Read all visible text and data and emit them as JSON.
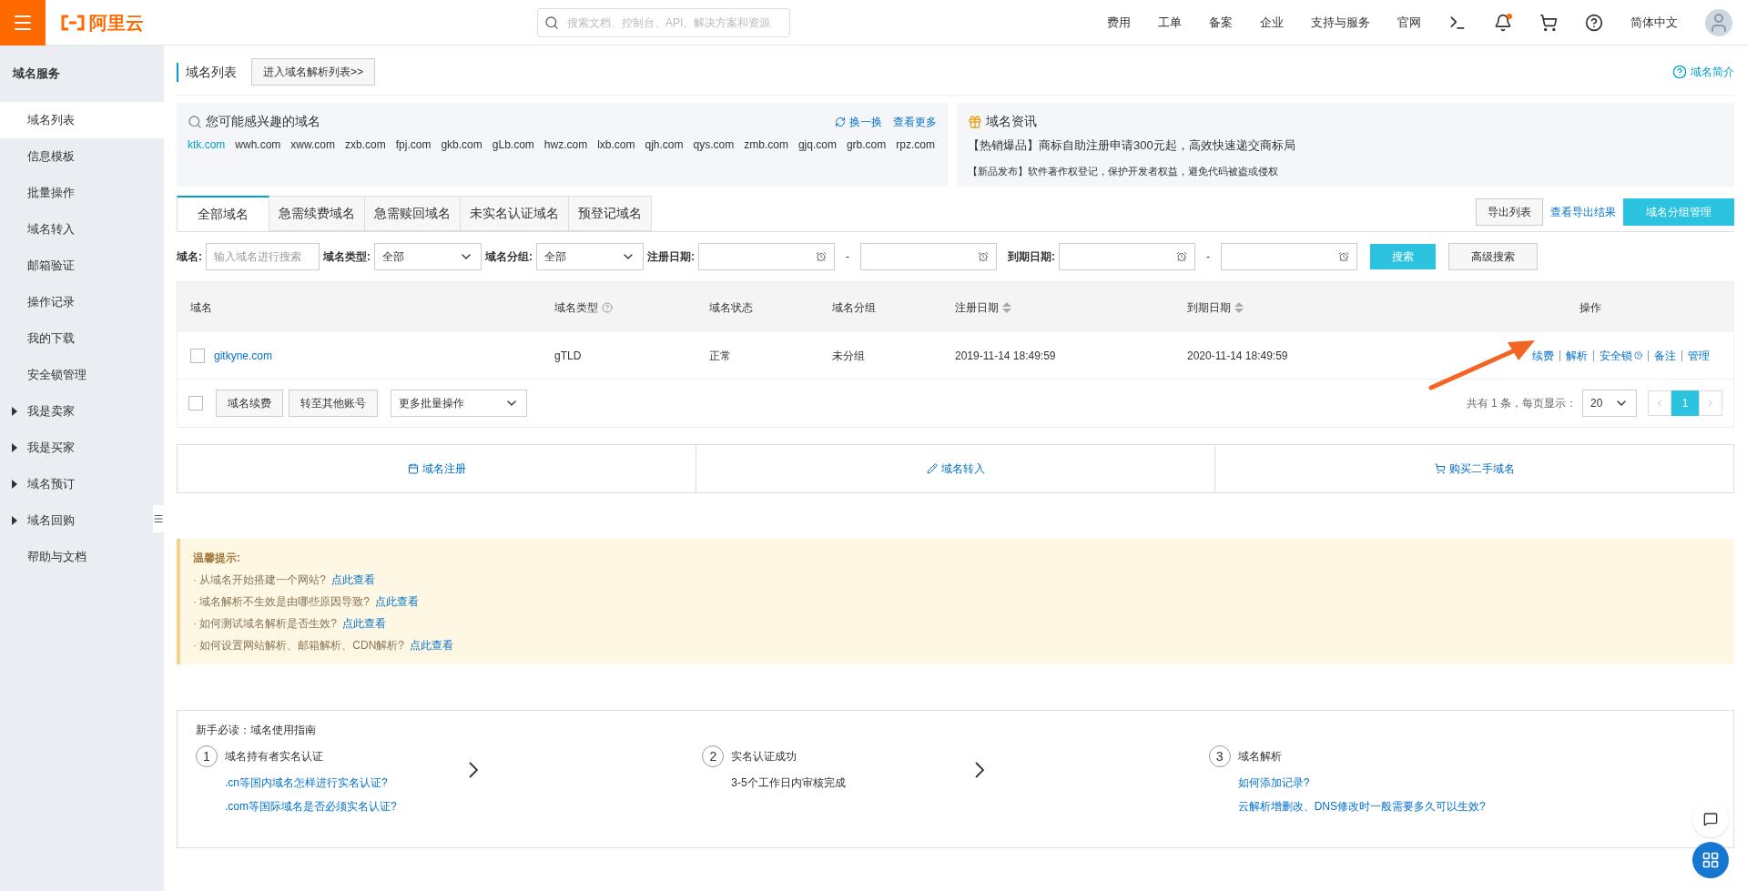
{
  "header": {
    "logo": "阿里云",
    "search": {
      "placeholder": "搜索文档、控制台、API、解决方案和资源"
    },
    "nav": [
      "费用",
      "工单",
      "备案",
      "企业",
      "支持与服务",
      "官网"
    ],
    "language": "简体中文",
    "notification_dot": true
  },
  "sidebar": {
    "title": "域名服务",
    "items": [
      {
        "label": "域名列表",
        "selected": true,
        "kind": "link"
      },
      {
        "label": "信息模板",
        "selected": false,
        "kind": "link"
      },
      {
        "label": "批量操作",
        "selected": false,
        "kind": "link"
      },
      {
        "label": "域名转入",
        "selected": false,
        "kind": "link"
      },
      {
        "label": "邮箱验证",
        "selected": false,
        "kind": "link"
      },
      {
        "label": "操作记录",
        "selected": false,
        "kind": "link"
      },
      {
        "label": "我的下载",
        "selected": false,
        "kind": "link"
      },
      {
        "label": "安全锁管理",
        "selected": false,
        "kind": "link"
      },
      {
        "label": "我是卖家",
        "selected": false,
        "kind": "group",
        "expanded": false
      },
      {
        "label": "我是买家",
        "selected": false,
        "kind": "group",
        "expanded": false
      },
      {
        "label": "域名预订",
        "selected": false,
        "kind": "group",
        "expanded": false
      },
      {
        "label": "域名回购",
        "selected": false,
        "kind": "group",
        "expanded": false
      },
      {
        "label": "帮助与文档",
        "selected": false,
        "kind": "link"
      }
    ]
  },
  "page": {
    "title": "域名列表",
    "dns_button": "进入域名解析列表>>",
    "intro_link": "域名简介"
  },
  "suggest": {
    "title": "您可能感兴趣的域名",
    "refresh": "换一换",
    "more": "查看更多",
    "domains": [
      {
        "name": "ktk.com",
        "highlighted": true
      },
      {
        "name": "wwh.com",
        "highlighted": false
      },
      {
        "name": "xww.com",
        "highlighted": false
      },
      {
        "name": "zxb.com",
        "highlighted": false
      },
      {
        "name": "fpj.com",
        "highlighted": false
      },
      {
        "name": "gkb.com",
        "highlighted": false
      },
      {
        "name": "gLb.com",
        "highlighted": false
      },
      {
        "name": "hwz.com",
        "highlighted": false
      },
      {
        "name": "lxb.com",
        "highlighted": false
      },
      {
        "name": "qjh.com",
        "highlighted": false
      },
      {
        "name": "qys.com",
        "highlighted": false
      },
      {
        "name": "zmb.com",
        "highlighted": false
      },
      {
        "name": "gjq.com",
        "highlighted": false
      },
      {
        "name": "grb.com",
        "highlighted": false
      },
      {
        "name": "rpz.com",
        "highlighted": false
      }
    ]
  },
  "news": {
    "title": "域名资讯",
    "headline": "【热销爆品】商标自助注册申请300元起，高效快速递交商标局",
    "item": "【新品发布】软件著作权登记，保护开发者权益，避免代码被盗或侵权"
  },
  "tabs": [
    {
      "label": "全部域名",
      "selected": true
    },
    {
      "label": "急需续费域名",
      "selected": false
    },
    {
      "label": "急需赎回域名",
      "selected": false
    },
    {
      "label": "未实名认证域名",
      "selected": false
    },
    {
      "label": "预登记域名",
      "selected": false
    }
  ],
  "actions": {
    "export": "导出列表",
    "export_result": "查看导出结果",
    "group_manage": "域名分组管理"
  },
  "filters": {
    "domain_label": "域名:",
    "domain_placeholder": "输入域名进行搜索",
    "type_label": "域名类型:",
    "type_value": "全部",
    "group_label": "域名分组:",
    "group_value": "全部",
    "reg_label": "注册日期:",
    "exp_label": "到期日期:",
    "dash1": "-",
    "dash2": "-",
    "search": "搜索",
    "advanced": "高级搜索"
  },
  "table": {
    "columns": [
      {
        "label": "域名",
        "kind": "plain"
      },
      {
        "label": "域名类型",
        "kind": "help"
      },
      {
        "label": "域名状态",
        "kind": "plain"
      },
      {
        "label": "域名分组",
        "kind": "plain"
      },
      {
        "label": "注册日期",
        "kind": "sort"
      },
      {
        "label": "到期日期",
        "kind": "sort"
      },
      {
        "label": "操作",
        "kind": "plain"
      }
    ],
    "rows": [
      {
        "checked": false,
        "domain": "gitkyne.com",
        "type": "gTLD",
        "status": "正常",
        "group": "未分组",
        "registered": "2019-11-14 18:49:59",
        "expires": "2020-11-14 18:49:59",
        "ops": [
          {
            "label": "续费",
            "help": false
          },
          {
            "label": "解析",
            "help": false
          },
          {
            "label": "安全锁",
            "help": true
          },
          {
            "label": "备注",
            "help": false
          },
          {
            "label": "管理",
            "help": false
          }
        ]
      }
    ]
  },
  "bulk": {
    "checked": false,
    "renew": "域名续费",
    "transfer": "转至其他账号",
    "more": "更多批量操作",
    "total": "共有 1 条，每页显示：",
    "page_size": "20",
    "pages": [
      {
        "label": "1",
        "selected": true
      }
    ]
  },
  "quick_links": [
    {
      "label": "域名注册",
      "kind": "register"
    },
    {
      "label": "域名转入",
      "kind": "transfer"
    },
    {
      "label": "购买二手域名",
      "kind": "buy"
    }
  ],
  "tips": {
    "title": "温馨提示:",
    "bullet": "·",
    "items": [
      {
        "text": "从域名开始搭建一个网站?",
        "link": "点此查看"
      },
      {
        "text": "域名解析不生效是由哪些原因导致?",
        "link": "点此查看"
      },
      {
        "text": "如何测试域名解析是否生效?",
        "link": "点此查看"
      },
      {
        "text": "如何设置网站解析、邮箱解析、CDN解析?",
        "link": "点此查看"
      }
    ]
  },
  "guide": {
    "title": "新手必读：域名使用指南",
    "steps": [
      {
        "number": "1",
        "title": "域名持有者实名认证",
        "lines": [
          {
            "text": ".cn等国内域名怎样进行实名认证?",
            "kind": "link"
          },
          {
            "text": ".com等国际域名是否必须实名认证?",
            "kind": "link"
          }
        ]
      },
      {
        "number": "2",
        "title": "实名认证成功",
        "lines": [
          {
            "text": "3-5个工作日内审核完成",
            "kind": "text"
          }
        ]
      },
      {
        "number": "3",
        "title": "域名解析",
        "lines": [
          {
            "text": "如何添加记录?",
            "kind": "link"
          },
          {
            "text": "云解析增删改、DNS修改时一般需要多久可以生效?",
            "kind": "link"
          }
        ]
      }
    ]
  }
}
